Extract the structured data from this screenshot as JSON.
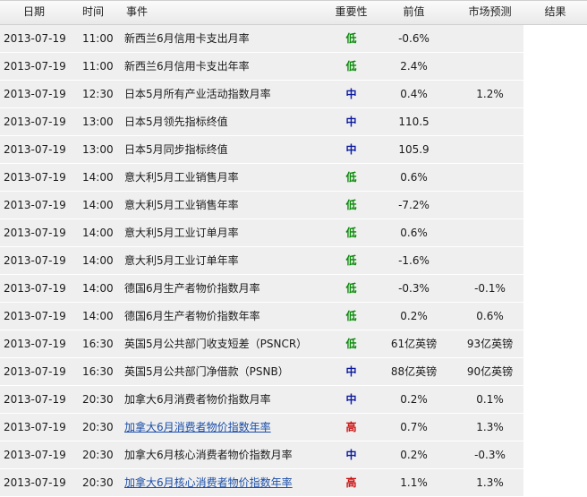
{
  "headers": [
    "日期",
    "时间",
    "事件",
    "重要性",
    "前值",
    "市场预测",
    "结果"
  ],
  "colors": {
    "low": "#0a8a0a",
    "mid": "#0b1aa0",
    "high": "#cc1111",
    "link": "#1a4ea8"
  },
  "rows": [
    {
      "date": "2013-07-19",
      "time": "11:00",
      "event": "新西兰6月信用卡支出月率",
      "importance": "低",
      "level": "low",
      "previous": "-0.6%",
      "forecast": "",
      "result": "",
      "link": false
    },
    {
      "date": "2013-07-19",
      "time": "11:00",
      "event": "新西兰6月信用卡支出年率",
      "importance": "低",
      "level": "low",
      "previous": "2.4%",
      "forecast": "",
      "result": "",
      "link": false
    },
    {
      "date": "2013-07-19",
      "time": "12:30",
      "event": "日本5月所有产业活动指数月率",
      "importance": "中",
      "level": "mid",
      "previous": "0.4%",
      "forecast": "1.2%",
      "result": "",
      "link": false
    },
    {
      "date": "2013-07-19",
      "time": "13:00",
      "event": "日本5月领先指标终值",
      "importance": "中",
      "level": "mid",
      "previous": "110.5",
      "forecast": "",
      "result": "",
      "link": false
    },
    {
      "date": "2013-07-19",
      "time": "13:00",
      "event": "日本5月同步指标终值",
      "importance": "中",
      "level": "mid",
      "previous": "105.9",
      "forecast": "",
      "result": "",
      "link": false
    },
    {
      "date": "2013-07-19",
      "time": "14:00",
      "event": "意大利5月工业销售月率",
      "importance": "低",
      "level": "low",
      "previous": "0.6%",
      "forecast": "",
      "result": "",
      "link": false
    },
    {
      "date": "2013-07-19",
      "time": "14:00",
      "event": "意大利5月工业销售年率",
      "importance": "低",
      "level": "low",
      "previous": "-7.2%",
      "forecast": "",
      "result": "",
      "link": false
    },
    {
      "date": "2013-07-19",
      "time": "14:00",
      "event": "意大利5月工业订单月率",
      "importance": "低",
      "level": "low",
      "previous": "0.6%",
      "forecast": "",
      "result": "",
      "link": false
    },
    {
      "date": "2013-07-19",
      "time": "14:00",
      "event": "意大利5月工业订单年率",
      "importance": "低",
      "level": "low",
      "previous": "-1.6%",
      "forecast": "",
      "result": "",
      "link": false
    },
    {
      "date": "2013-07-19",
      "time": "14:00",
      "event": "德国6月生产者物价指数月率",
      "importance": "低",
      "level": "low",
      "previous": "-0.3%",
      "forecast": "-0.1%",
      "result": "",
      "link": false
    },
    {
      "date": "2013-07-19",
      "time": "14:00",
      "event": "德国6月生产者物价指数年率",
      "importance": "低",
      "level": "low",
      "previous": "0.2%",
      "forecast": "0.6%",
      "result": "",
      "link": false
    },
    {
      "date": "2013-07-19",
      "time": "16:30",
      "event": "英国5月公共部门收支短差（PSNCR）",
      "importance": "低",
      "level": "low",
      "previous": "61亿英镑",
      "forecast": "93亿英镑",
      "result": "",
      "link": false
    },
    {
      "date": "2013-07-19",
      "time": "16:30",
      "event": "英国5月公共部门净借款（PSNB）",
      "importance": "中",
      "level": "mid",
      "previous": "88亿英镑",
      "forecast": "90亿英镑",
      "result": "",
      "link": false
    },
    {
      "date": "2013-07-19",
      "time": "20:30",
      "event": "加拿大6月消费者物价指数月率",
      "importance": "中",
      "level": "mid",
      "previous": "0.2%",
      "forecast": "0.1%",
      "result": "",
      "link": false
    },
    {
      "date": "2013-07-19",
      "time": "20:30",
      "event": "加拿大6月消费者物价指数年率",
      "importance": "高",
      "level": "high",
      "previous": "0.7%",
      "forecast": "1.3%",
      "result": "",
      "link": true
    },
    {
      "date": "2013-07-19",
      "time": "20:30",
      "event": "加拿大6月核心消费者物价指数月率",
      "importance": "中",
      "level": "mid",
      "previous": "0.2%",
      "forecast": "-0.3%",
      "result": "",
      "link": false
    },
    {
      "date": "2013-07-19",
      "time": "20:30",
      "event": "加拿大6月核心消费者物价指数年率",
      "importance": "高",
      "level": "high",
      "previous": "1.1%",
      "forecast": "1.3%",
      "result": "",
      "link": true
    }
  ]
}
